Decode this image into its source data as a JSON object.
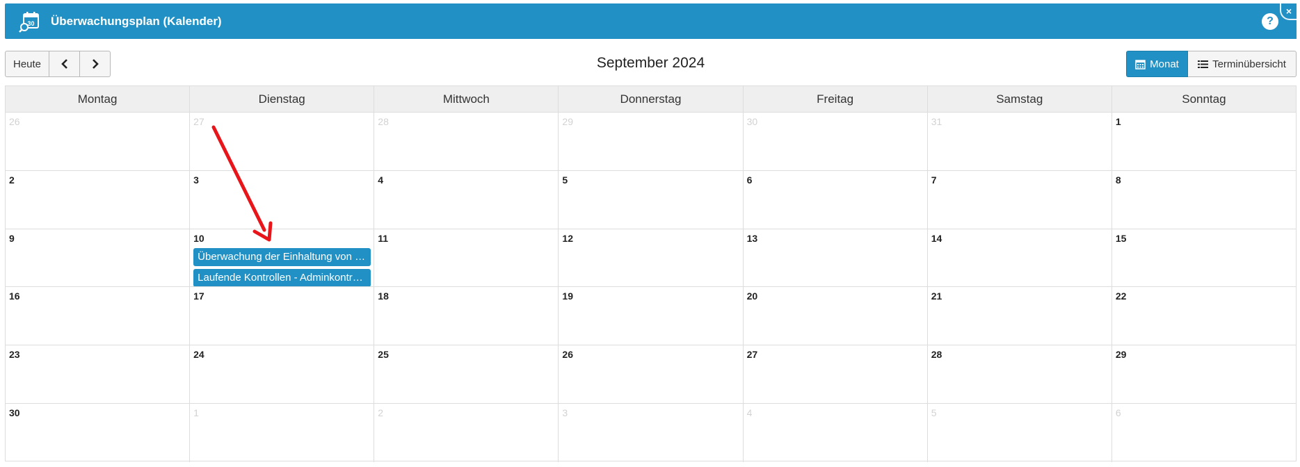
{
  "header": {
    "title": "Überwachungsplan (Kalender)",
    "title_icon": "calendar-search-icon",
    "help_label": "?",
    "close_label": "×"
  },
  "toolbar": {
    "today_label": "Heute",
    "prev_icon": "chevron-left-icon",
    "next_icon": "chevron-right-icon",
    "month_title": "September 2024",
    "month_view_label": "Monat",
    "agenda_view_label": "Terminübersicht"
  },
  "calendar": {
    "weekdays": [
      "Montag",
      "Dienstag",
      "Mittwoch",
      "Donnerstag",
      "Freitag",
      "Samstag",
      "Sonntag"
    ],
    "weeks": [
      [
        {
          "num": "26",
          "other": true
        },
        {
          "num": "27",
          "other": true
        },
        {
          "num": "28",
          "other": true
        },
        {
          "num": "29",
          "other": true
        },
        {
          "num": "30",
          "other": true
        },
        {
          "num": "31",
          "other": true
        },
        {
          "num": "1",
          "other": false
        }
      ],
      [
        {
          "num": "2",
          "other": false
        },
        {
          "num": "3",
          "other": false
        },
        {
          "num": "4",
          "other": false
        },
        {
          "num": "5",
          "other": false
        },
        {
          "num": "6",
          "other": false
        },
        {
          "num": "7",
          "other": false
        },
        {
          "num": "8",
          "other": false
        }
      ],
      [
        {
          "num": "9",
          "other": false
        },
        {
          "num": "10",
          "other": false,
          "events": [
            "Überwachung der Einhaltung von Datenschutzvorgaben",
            "Laufende Kontrollen - Adminkontrollen"
          ]
        },
        {
          "num": "11",
          "other": false
        },
        {
          "num": "12",
          "other": false
        },
        {
          "num": "13",
          "other": false
        },
        {
          "num": "14",
          "other": false
        },
        {
          "num": "15",
          "other": false
        }
      ],
      [
        {
          "num": "16",
          "other": false
        },
        {
          "num": "17",
          "other": false
        },
        {
          "num": "18",
          "other": false
        },
        {
          "num": "19",
          "other": false
        },
        {
          "num": "20",
          "other": false
        },
        {
          "num": "21",
          "other": false
        },
        {
          "num": "22",
          "other": false
        }
      ],
      [
        {
          "num": "23",
          "other": false
        },
        {
          "num": "24",
          "other": false
        },
        {
          "num": "25",
          "other": false
        },
        {
          "num": "26",
          "other": false
        },
        {
          "num": "27",
          "other": false
        },
        {
          "num": "28",
          "other": false
        },
        {
          "num": "29",
          "other": false
        }
      ],
      [
        {
          "num": "30",
          "other": false
        },
        {
          "num": "1",
          "other": true
        },
        {
          "num": "2",
          "other": true
        },
        {
          "num": "3",
          "other": true
        },
        {
          "num": "4",
          "other": true
        },
        {
          "num": "5",
          "other": true
        },
        {
          "num": "6",
          "other": true
        }
      ]
    ]
  },
  "colors": {
    "accent": "#2191c5",
    "annotation_arrow": "#e8161b"
  }
}
